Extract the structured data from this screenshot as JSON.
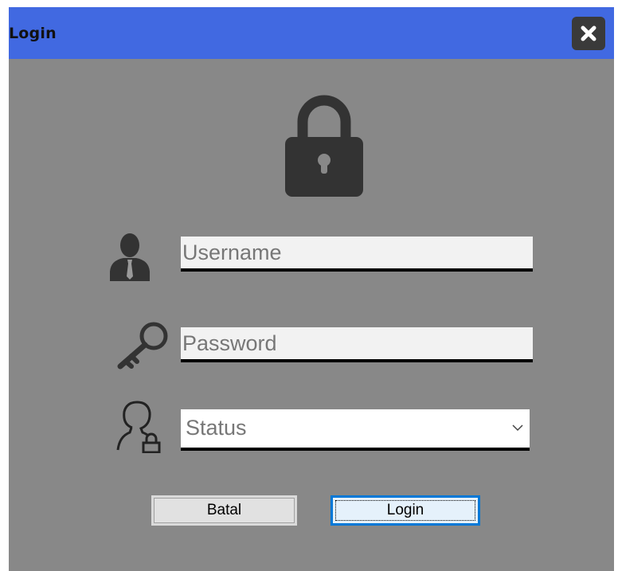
{
  "window": {
    "title": "Login",
    "colors": {
      "titlebar": "#4169e1",
      "background": "#888888",
      "close_button": "#3a3a3a"
    }
  },
  "icons": {
    "close": "close-x-icon",
    "lock": "padlock-icon",
    "user": "user-icon",
    "password": "key-icon",
    "status": "user-lock-icon",
    "dropdown": "chevron-down-icon"
  },
  "form": {
    "username": {
      "placeholder": "Username",
      "value": ""
    },
    "password": {
      "placeholder": "Password",
      "value": ""
    },
    "status": {
      "selected": "Status"
    }
  },
  "buttons": {
    "cancel_label": "Batal",
    "login_label": "Login"
  }
}
